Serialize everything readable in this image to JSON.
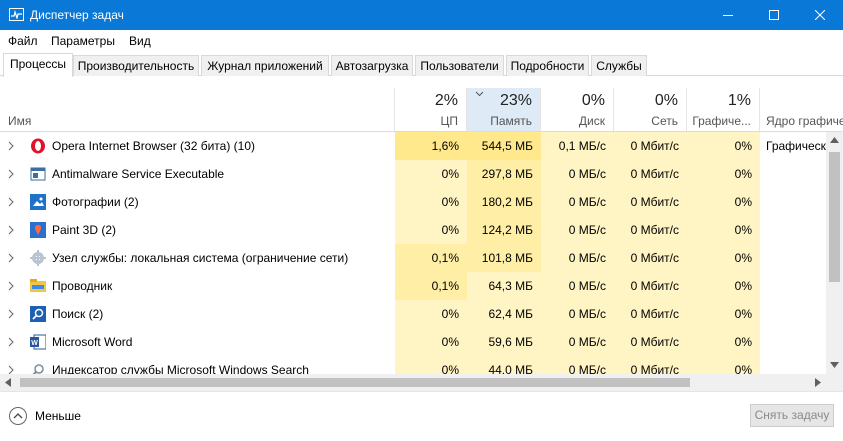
{
  "window": {
    "title": "Диспетчер задач"
  },
  "menu": [
    "Файл",
    "Параметры",
    "Вид"
  ],
  "tabs": [
    "Процессы",
    "Производительность",
    "Журнал приложений",
    "Автозагрузка",
    "Пользователи",
    "Подробности",
    "Службы"
  ],
  "active_tab": "Процессы",
  "columns": {
    "name": {
      "label": "Имя"
    },
    "cpu": {
      "percent": "2%",
      "label": "ЦП"
    },
    "memory": {
      "percent": "23%",
      "label": "Память"
    },
    "disk": {
      "percent": "0%",
      "label": "Диск"
    },
    "network": {
      "percent": "0%",
      "label": "Сеть"
    },
    "gpu": {
      "percent": "1%",
      "label": "Графиче..."
    },
    "gpu_engine": {
      "label": "Ядро графичес"
    }
  },
  "processes": [
    {
      "name": "Opera Internet Browser (32 бита) (10)",
      "icon": "opera-icon",
      "cpu": "1,6%",
      "memory": "544,5 МБ",
      "disk": "0,1 МБ/с",
      "network": "0 Мбит/с",
      "gpu": "0%",
      "gpu_engine": "Графическ"
    },
    {
      "name": "Antimalware Service Executable",
      "icon": "antimalware-icon",
      "cpu": "0%",
      "memory": "297,8 МБ",
      "disk": "0 МБ/с",
      "network": "0 Мбит/с",
      "gpu": "0%",
      "gpu_engine": ""
    },
    {
      "name": "Фотографии (2)",
      "icon": "photos-icon",
      "cpu": "0%",
      "memory": "180,2 МБ",
      "disk": "0 МБ/с",
      "network": "0 Мбит/с",
      "gpu": "0%",
      "gpu_engine": ""
    },
    {
      "name": "Paint 3D (2)",
      "icon": "paint3d-icon",
      "cpu": "0%",
      "memory": "124,2 МБ",
      "disk": "0 МБ/с",
      "network": "0 Мбит/с",
      "gpu": "0%",
      "gpu_engine": ""
    },
    {
      "name": "Узел службы: локальная система (ограничение сети)",
      "icon": "service-host-icon",
      "cpu": "0,1%",
      "memory": "101,8 МБ",
      "disk": "0 МБ/с",
      "network": "0 Мбит/с",
      "gpu": "0%",
      "gpu_engine": ""
    },
    {
      "name": "Проводник",
      "icon": "explorer-icon",
      "cpu": "0,1%",
      "memory": "64,3 МБ",
      "disk": "0 МБ/с",
      "network": "0 Мбит/с",
      "gpu": "0%",
      "gpu_engine": ""
    },
    {
      "name": "Поиск (2)",
      "icon": "search-icon",
      "cpu": "0%",
      "memory": "62,4 МБ",
      "disk": "0 МБ/с",
      "network": "0 Мбит/с",
      "gpu": "0%",
      "gpu_engine": ""
    },
    {
      "name": "Microsoft Word",
      "icon": "word-icon",
      "cpu": "0%",
      "memory": "59,6 МБ",
      "disk": "0 МБ/с",
      "network": "0 Мбит/с",
      "gpu": "0%",
      "gpu_engine": ""
    },
    {
      "name": "Индексатор службы Microsoft Windows Search",
      "icon": "indexer-icon",
      "cpu": "0%",
      "memory": "44,0 МБ",
      "disk": "0 МБ/с",
      "network": "0 Мбит/с",
      "gpu": "0%",
      "gpu_engine": ""
    }
  ],
  "footer": {
    "less_label": "Меньше",
    "end_task_label": "Снять задачу"
  },
  "colors": {
    "titlebar": "#0a78d7",
    "heat_light": "#fff4c4",
    "heat_medium": "#ffefa6",
    "heat_strong": "#ffe98c",
    "sorted_header": "#deeaf6"
  }
}
